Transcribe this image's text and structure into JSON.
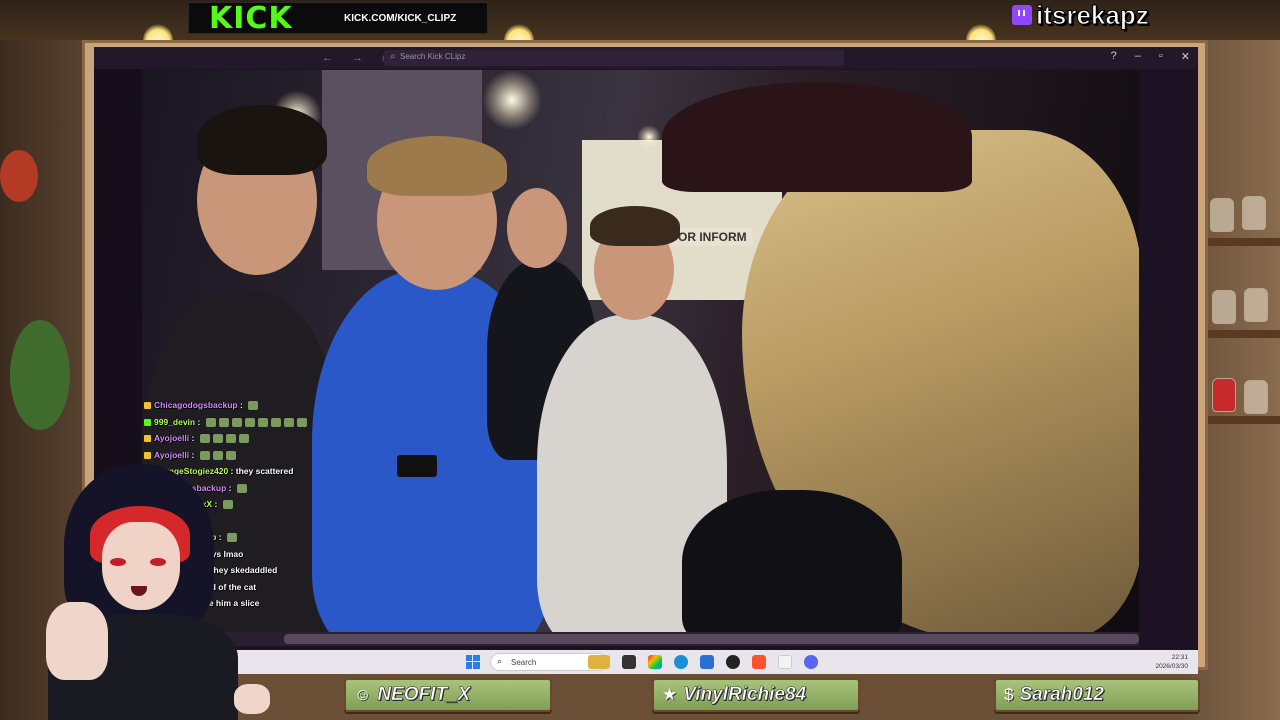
{
  "overlay": {
    "kick_logo": "KICK",
    "kick_url": "KICK.COM/KICK_CLIPZ",
    "streamer_name": "itsrekapz",
    "accent_kick": "#53fc18",
    "accent_twitch": "#9146ff"
  },
  "browser": {
    "search_placeholder": "Search Kick CLipz",
    "nav_icons": [
      "back-icon",
      "forward-icon",
      "history-icon"
    ],
    "window_controls": [
      "help-icon",
      "minimize-icon",
      "maximize-icon",
      "close-icon"
    ]
  },
  "video": {
    "sign_text": "OR INFORM"
  },
  "chat": [
    {
      "user": "Chicagodogsbackup",
      "msg": "",
      "color": "#d68cff",
      "emotes": 1
    },
    {
      "user": "999_devin",
      "msg": "",
      "color": "#b7ff5a",
      "emotes": 8
    },
    {
      "user": "Ayojoelli",
      "msg": "",
      "color": "#d68cff",
      "emotes": 4
    },
    {
      "user": "Ayojoelli",
      "msg": "",
      "color": "#d68cff",
      "emotes": 3
    },
    {
      "user": "SavageStogiez420",
      "msg": "they scattered",
      "color": "#b7ff5a",
      "emotes": 0
    },
    {
      "user": "icagodogsbackup",
      "msg": "",
      "color": "#d68cff",
      "emotes": 1
    },
    {
      "user": "Goofy_Asf_xX",
      "msg": "",
      "color": "#b7ff5a",
      "emotes": 1
    },
    {
      "user": "ny303",
      "msg": "",
      "color": "#d68cff",
      "emotes": 1
    },
    {
      "user": "hatNotsBackup",
      "msg": "",
      "color": "#b7ff5a",
      "emotes": 1
    },
    {
      "user": "en115",
      "msg": "frat boys lmao",
      "color": "#d68cff",
      "emotes": 0
    },
    {
      "user": "eStogiez420",
      "msg": "they skedaddled",
      "color": "#b7ff5a",
      "emotes": 0
    },
    {
      "user": "ix",
      "msg": "they scared of the cat",
      "color": "#d68cff",
      "emotes": 0
    },
    {
      "user": "e2st0ner",
      "msg": "give him a slice",
      "color": "#d68cff",
      "emotes": 0
    },
    {
      "user": "",
      "msg": "",
      "color": "#d68cff",
      "emotes": 1
    }
  ],
  "taskbar": {
    "search_label": "Search",
    "time": "22:31",
    "date": "2026/03/30"
  },
  "plates": [
    {
      "icon": "person-icon",
      "glyph": "☺",
      "name": "NEOFIT_X"
    },
    {
      "icon": "star-icon",
      "glyph": "★",
      "name": "VinylRichie84"
    },
    {
      "icon": "dollar-icon",
      "glyph": "$",
      "name": "Sarah012"
    }
  ]
}
